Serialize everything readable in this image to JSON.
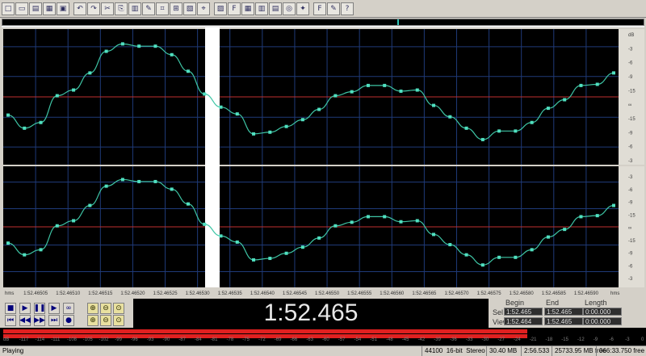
{
  "toolbar": {
    "buttons": [
      {
        "icon": "new-file-icon",
        "glyph": "□"
      },
      {
        "icon": "open-icon",
        "glyph": "▭"
      },
      {
        "icon": "save-icon",
        "glyph": "▤"
      },
      {
        "icon": "save-as-icon",
        "glyph": "▦"
      },
      {
        "icon": "print-icon",
        "glyph": "▣"
      },
      {
        "icon": "undo-icon",
        "glyph": "↶"
      },
      {
        "icon": "redo-icon",
        "glyph": "↷"
      },
      {
        "icon": "cut-icon",
        "glyph": "✂"
      },
      {
        "icon": "copy-icon",
        "glyph": "⎘"
      },
      {
        "icon": "paste-icon",
        "glyph": "▥"
      },
      {
        "icon": "pencil-icon",
        "glyph": "✎"
      },
      {
        "icon": "trim-icon",
        "glyph": "⌗"
      },
      {
        "icon": "mix-paste-icon",
        "glyph": "⊞"
      },
      {
        "icon": "paste-new-icon",
        "glyph": "▧"
      },
      {
        "icon": "crop-icon",
        "glyph": "⌖"
      },
      {
        "icon": "waveform-view-icon",
        "glyph": "▨"
      },
      {
        "icon": "frequency-icon",
        "glyph": "F"
      },
      {
        "icon": "grid-icon",
        "glyph": "▦"
      },
      {
        "icon": "mixer-icon",
        "glyph": "▥"
      },
      {
        "icon": "playlist-icon",
        "glyph": "▤"
      },
      {
        "icon": "cd-icon",
        "glyph": "◎"
      },
      {
        "icon": "wizard-icon",
        "glyph": "✦"
      },
      {
        "icon": "script-icon",
        "glyph": "F"
      },
      {
        "icon": "effects-icon",
        "glyph": "✎"
      },
      {
        "icon": "help-icon",
        "glyph": "?"
      }
    ]
  },
  "waveform": {
    "time_labels": [
      "1:52.46505",
      "1:52.46510",
      "1:52.46515",
      "1:52.46520",
      "1:52.46525",
      "1:52.46530",
      "1:52.46535",
      "1:52.46540",
      "1:52.46545",
      "1:52.46550",
      "1:52.46555",
      "1:52.46560",
      "1:52.46565",
      "1:52.46570",
      "1:52.46575",
      "1:52.46580",
      "1:52.46585",
      "1:52.46590"
    ],
    "left_unit": "hms",
    "right_unit": "hms",
    "db_labels_top": [
      "dB",
      "-3",
      "-6",
      "-9",
      "-15",
      "∞",
      "-15",
      "-9",
      "-6",
      "-3"
    ],
    "db_labels_bottom": [
      "-3",
      "-6",
      "-9",
      "-15",
      "∞",
      "-15",
      "-9",
      "-6",
      "-3"
    ],
    "channel_top": [
      -0.32,
      -0.55,
      -0.45,
      0.02,
      0.12,
      0.42,
      0.8,
      0.93,
      0.89,
      0.89,
      0.74,
      0.45,
      0.05,
      -0.18,
      -0.3,
      -0.65,
      -0.62,
      -0.52,
      -0.4,
      -0.22,
      0.02,
      0.09,
      0.2,
      0.2,
      0.1,
      0.12,
      -0.15,
      -0.35,
      -0.55,
      -0.75,
      -0.6,
      -0.6,
      -0.45,
      -0.2,
      -0.05,
      0.2,
      0.22,
      0.42
    ],
    "channel_bottom": [
      -0.32,
      -0.55,
      -0.45,
      0.02,
      0.12,
      0.42,
      0.8,
      0.93,
      0.89,
      0.89,
      0.74,
      0.45,
      0.05,
      -0.18,
      -0.3,
      -0.65,
      -0.62,
      -0.52,
      -0.4,
      -0.22,
      0.02,
      0.09,
      0.2,
      0.2,
      0.1,
      0.12,
      -0.15,
      -0.35,
      -0.55,
      -0.75,
      -0.6,
      -0.6,
      -0.45,
      -0.2,
      -0.05,
      0.2,
      0.22,
      0.42
    ],
    "colors": {
      "background": "#000000",
      "grid": "#1f3a78",
      "waveform": "#3ec5a5",
      "point": "#50e0c0",
      "center": "#c03030",
      "selection": "#ffffff",
      "selected_wave": "#101060"
    }
  },
  "transport": {
    "buttons": [
      {
        "name": "stop-button",
        "icon": "stop-icon",
        "glyph": "■"
      },
      {
        "name": "play-button",
        "icon": "play-icon",
        "glyph": "▶"
      },
      {
        "name": "pause-button",
        "icon": "pause-icon",
        "glyph": "❚❚"
      },
      {
        "name": "play-to-end-button",
        "icon": "play-end-icon",
        "glyph": "▶"
      },
      {
        "name": "loop-button",
        "icon": "loop-icon",
        "glyph": "∞"
      },
      {
        "name": "go-start-button",
        "icon": "go-start-icon",
        "glyph": "⏮"
      },
      {
        "name": "rewind-button",
        "icon": "rewind-icon",
        "glyph": "◀◀"
      },
      {
        "name": "forward-button",
        "icon": "forward-icon",
        "glyph": "▶▶"
      },
      {
        "name": "go-end-button",
        "icon": "go-end-icon",
        "glyph": "⏭"
      },
      {
        "name": "record-button",
        "icon": "record-icon",
        "glyph": "●"
      }
    ],
    "zoom_buttons": [
      {
        "name": "zoom-in-h-button",
        "glyph": "⊕"
      },
      {
        "name": "zoom-out-h-button",
        "glyph": "⊖"
      },
      {
        "name": "zoom-full-button",
        "glyph": "⊙"
      },
      {
        "name": "zoom-in-v-button",
        "glyph": "⊕"
      },
      {
        "name": "zoom-out-v-button",
        "glyph": "⊖"
      },
      {
        "name": "zoom-sel-button",
        "glyph": "⊙"
      }
    ],
    "time": "1:52.465"
  },
  "selection": {
    "headers": {
      "begin": "Begin",
      "end": "End",
      "length": "Length"
    },
    "sel_label": "Sel",
    "view_label": "View",
    "sel_begin": "1:52.465",
    "sel_end": "1:52.465",
    "sel_length": "0:00.000",
    "view_begin": "1:52.464",
    "view_end": "1:52.465",
    "view_length": "0:00.000"
  },
  "meter": {
    "level_top": 0.82,
    "level_bottom": 0.82,
    "scale": [
      "dB",
      "-117",
      "-114",
      "-111",
      "-108",
      "-105",
      "-102",
      "-99",
      "-96",
      "-93",
      "-90",
      "-87",
      "-84",
      "-81",
      "-78",
      "-75",
      "-72",
      "-69",
      "-66",
      "-63",
      "-60",
      "-57",
      "-54",
      "-51",
      "-48",
      "-45",
      "-42",
      "-39",
      "-36",
      "-33",
      "-30",
      "-27",
      "-24",
      "-21",
      "-18",
      "-15",
      "-12",
      "-9",
      "-6",
      "-3",
      "0"
    ]
  },
  "status": {
    "state": "Playing",
    "format_rate": "44100",
    "format_bits": "16-bit",
    "format_channels": "Stereo",
    "file_size": "30.40 MB",
    "duration": "2:56.533",
    "disk_free": "25733.95 MB free",
    "time_free": "066:33.750 free"
  }
}
